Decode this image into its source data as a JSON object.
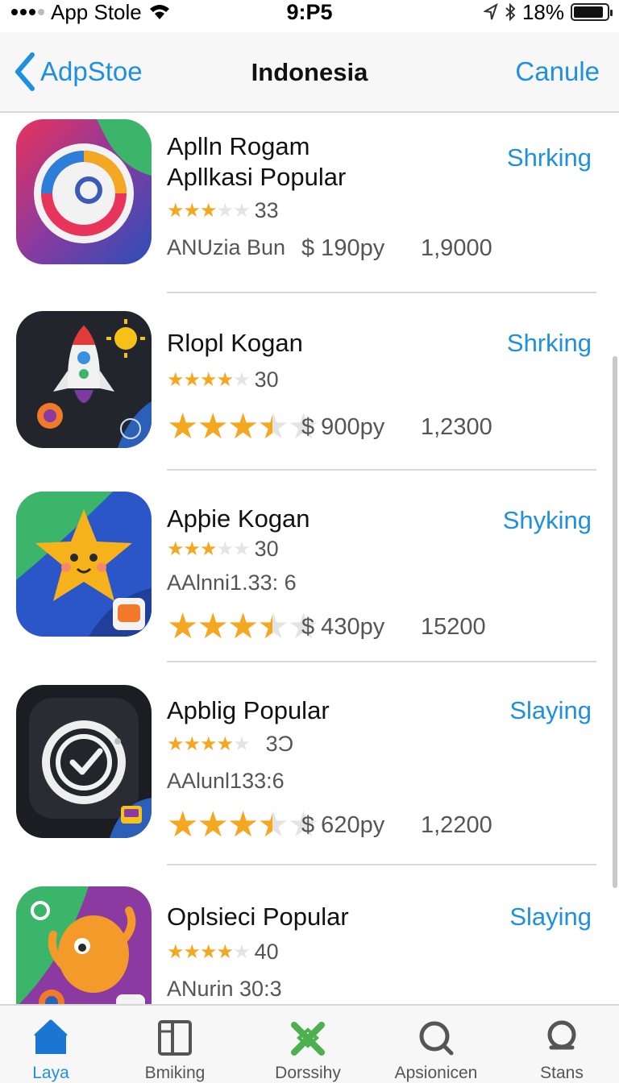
{
  "status_bar": {
    "carrier": "App Stole",
    "time": "9:P5",
    "battery": "18%",
    "battery_level": 0.9
  },
  "nav": {
    "back_label": "AdpStoe",
    "title": "Indonesia",
    "cancel_label": "Canule"
  },
  "apps": [
    {
      "name_line1": "Aplln Rogam",
      "name_line2": "Apllkasi Popular",
      "action": "Shrking",
      "rating_count": "33",
      "rating": 3,
      "meta": "ANUzia Bun",
      "price": "$ 190py",
      "downloads": "1,9000",
      "icon": "colorful-ring-icon"
    },
    {
      "name_line1": "Rlopl Kogan",
      "action": "Shrking",
      "rating_count": "30",
      "rating": 4,
      "big_rating": 3.5,
      "price": "$ 900py",
      "downloads": "1,2300",
      "icon": "rocket-icon"
    },
    {
      "name_line1": "Apþie Kogan",
      "action": "Shyking",
      "rating_count": "30",
      "rating": 3,
      "meta": "AAlnni1.33: 6",
      "big_rating": 3.5,
      "price": "$ 430py",
      "downloads": "15200",
      "icon": "star-character-icon"
    },
    {
      "name_line1": "Apblig Popular",
      "action": "Slaying",
      "rating_count": "3Ɔ",
      "rating": 4,
      "meta": "AAlunl133:6",
      "big_rating": 3.5,
      "price": "$ 620py",
      "downloads": "1,2200",
      "icon": "checkmark-dial-icon"
    },
    {
      "name_line1": "Oplsieci Popular",
      "action": "Slaying",
      "rating_count": "40",
      "rating": 4,
      "meta": "ANurin 30:3",
      "icon": "orange-character-icon"
    }
  ],
  "tabs": [
    {
      "label": "Laya",
      "icon": "home-icon",
      "active": true
    },
    {
      "label": "Bmiking",
      "icon": "book-icon",
      "active": false
    },
    {
      "label": "Dorssihy",
      "icon": "games-icon",
      "active": false
    },
    {
      "label": "Apsionicen",
      "icon": "search-icon",
      "active": false
    },
    {
      "label": "Stans",
      "icon": "search-icon",
      "active": false
    }
  ],
  "colors": {
    "accent": "#1f8fe0",
    "star": "#f4a720",
    "tab_active_icon": "#1a76d2",
    "tab_games_icon": "#4caf50"
  }
}
